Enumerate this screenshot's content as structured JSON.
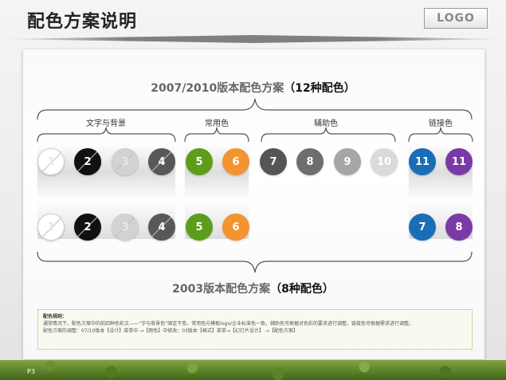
{
  "header": {
    "title": "配色方案说明",
    "logo": "LOGO"
  },
  "scheme_2007": {
    "prefix": "2007/2010版本配色方案",
    "count": "（12种配色）"
  },
  "scheme_2003": {
    "prefix": "2003版本配色方案",
    "count": "（8种配色）"
  },
  "groups": {
    "text_bg": "文字与背景",
    "common": "常用色",
    "auxiliary": "辅助色",
    "link": "链接色"
  },
  "colors": {
    "c1": "#ffffff",
    "c2": "#111111",
    "c3": "#d2d2d2",
    "c4": "#585858",
    "c5": "#5c9e1a",
    "c6": "#f39431",
    "c7": "#555555",
    "c8": "#6e6e6e",
    "c9": "#a6a6a6",
    "c10": "#dadada",
    "c11a": "#1a6eb8",
    "c11b": "#7a3aa6"
  },
  "row_top": [
    "1",
    "2",
    "3",
    "4",
    "5",
    "6",
    "7",
    "8",
    "9",
    "10",
    "11",
    "11"
  ],
  "row_bottom": [
    "1",
    "2",
    "3",
    "4",
    "5",
    "6",
    "7",
    "8"
  ],
  "note": {
    "heading": "配色规则：",
    "line1": "通常情况下，配色方案中的前四种色彩文——“字与背景色”固定不变。常用色与模板logo/企业标准色一致，辅助色可根据对色彩的要求进行调整，链接色可根据需求进行调整。",
    "line2": "配色方案的调整：07/10版本【设计】菜单中 →【颜色】中修改；03版本【格式】菜单→【幻灯片设计】 →【配色方案】"
  },
  "footer": {
    "page": "P3"
  }
}
